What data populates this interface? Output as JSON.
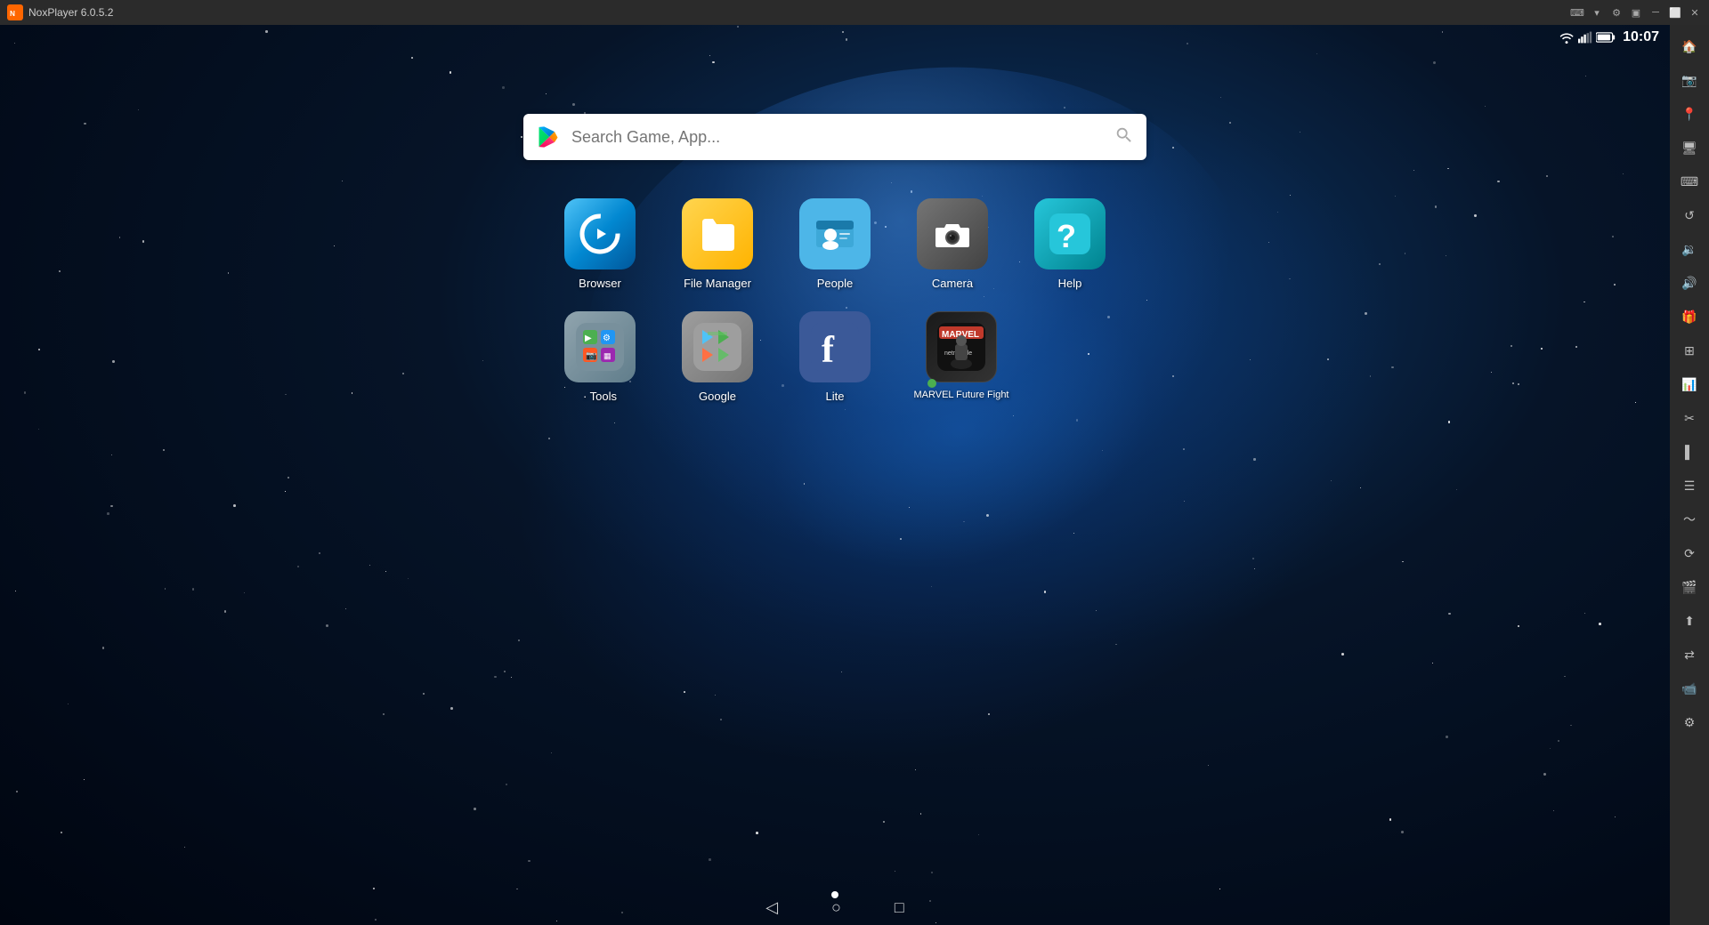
{
  "titlebar": {
    "logo_label": "Nox",
    "title": "NoxPlayer 6.0.5.2",
    "controls": [
      "keyboard-icon",
      "arrow-down-icon",
      "settings-icon",
      "monitor-icon",
      "minimize-icon",
      "restore-icon",
      "close-icon"
    ]
  },
  "statusbar": {
    "time": "10:07",
    "wifi": "wifi",
    "signal": "signal",
    "battery": "battery"
  },
  "search": {
    "placeholder": "Search Game, App..."
  },
  "apps_row1": [
    {
      "id": "browser",
      "label": "Browser"
    },
    {
      "id": "file_manager",
      "label": "File Manager"
    },
    {
      "id": "people",
      "label": "People"
    },
    {
      "id": "camera",
      "label": "Camera"
    },
    {
      "id": "help",
      "label": "Help"
    }
  ],
  "apps_row2": [
    {
      "id": "tools",
      "label": "· Tools"
    },
    {
      "id": "google",
      "label": "Google"
    },
    {
      "id": "lite",
      "label": "Lite"
    },
    {
      "id": "marvel",
      "label": "MARVEL Future Fight"
    }
  ],
  "sidebar_icons": [
    "home-icon",
    "screenshot-icon",
    "location-icon",
    "screen-icon",
    "keyboard-icon",
    "rotate-icon",
    "volume-down-icon",
    "volume-up-icon",
    "gift-icon",
    "grid-icon",
    "chart-icon",
    "scissors-icon",
    "bar-icon",
    "menu-icon",
    "shake-icon",
    "refresh-icon",
    "video-icon",
    "upload-icon",
    "sync-icon",
    "camera-icon",
    "settings-icon"
  ],
  "bottom_nav": {
    "back": "◁",
    "home": "○",
    "recent": "□"
  },
  "page_indicator": {
    "dots": [
      true
    ]
  }
}
